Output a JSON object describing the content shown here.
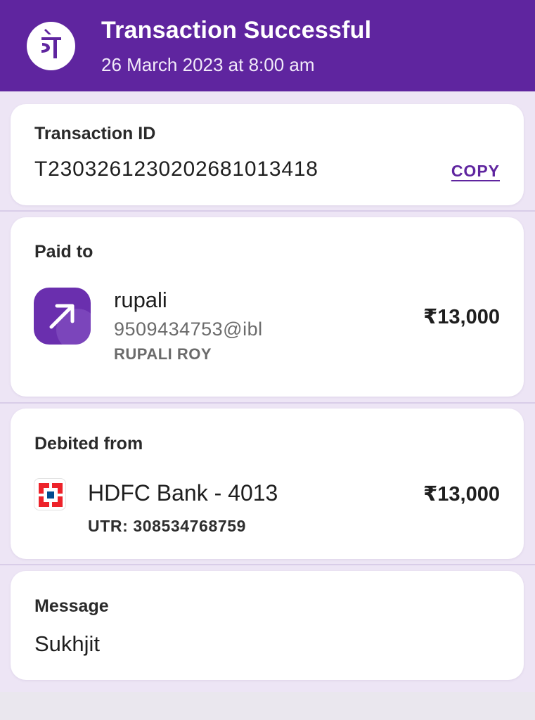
{
  "header": {
    "title": "Transaction Successful",
    "subtitle": "26 March 2023 at 8:00 am",
    "logo_icon": "phonepe-logo",
    "background_color": "#5f259f"
  },
  "transaction": {
    "label": "Transaction ID",
    "id": "T2303261230202681013418",
    "copy_label": "COPY"
  },
  "paid_to": {
    "label": "Paid to",
    "icon": "arrow-up-right-icon",
    "name": "rupali",
    "upi_id": "9509434753@ibl",
    "legal_name": "RUPALI ROY",
    "amount": "₹13,000"
  },
  "debited_from": {
    "label": "Debited from",
    "icon": "hdfc-bank-logo",
    "account": "HDFC Bank - 4013",
    "utr": "UTR: 308534768759",
    "amount": "₹13,000"
  },
  "message": {
    "label": "Message",
    "text": "Sukhjit"
  }
}
